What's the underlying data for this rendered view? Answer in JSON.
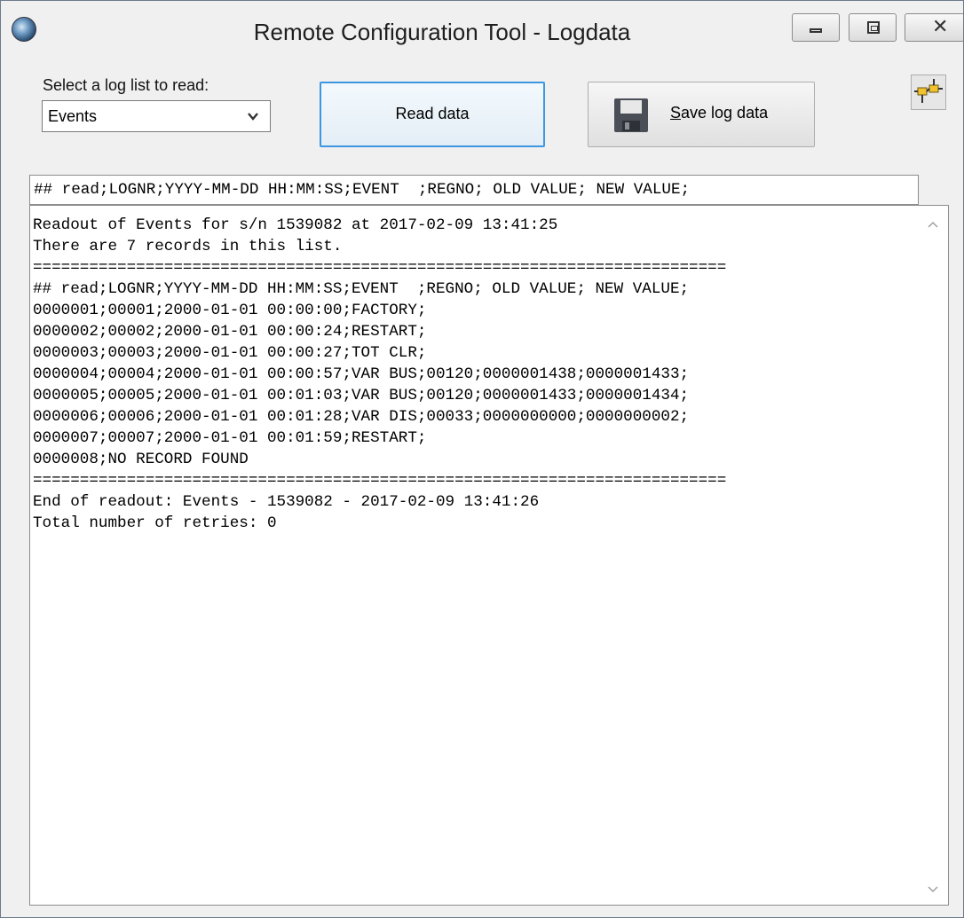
{
  "window": {
    "title": "Remote Configuration Tool - Logdata",
    "close_glyph": "✕"
  },
  "controls": {
    "select_label": "Select a log list to read:",
    "selected_list": "Events",
    "read_button": "Read data",
    "save_button_mnemonic": "S",
    "save_button_rest": "ave log data"
  },
  "header_line": "## read;LOGNR;YYYY-MM-DD HH:MM:SS;EVENT  ;REGNO; OLD VALUE; NEW VALUE;",
  "log": {
    "lines": [
      "Readout of Events for s/n 1539082 at 2017-02-09 13:41:25",
      "There are 7 records in this list.",
      "==========================================================================",
      "## read;LOGNR;YYYY-MM-DD HH:MM:SS;EVENT  ;REGNO; OLD VALUE; NEW VALUE;",
      "0000001;00001;2000-01-01 00:00:00;FACTORY;",
      "0000002;00002;2000-01-01 00:00:24;RESTART;",
      "0000003;00003;2000-01-01 00:00:27;TOT CLR;",
      "0000004;00004;2000-01-01 00:00:57;VAR BUS;00120;0000001438;0000001433;",
      "0000005;00005;2000-01-01 00:01:03;VAR BUS;00120;0000001433;0000001434;",
      "0000006;00006;2000-01-01 00:01:28;VAR DIS;00033;0000000000;0000000002;",
      "0000007;00007;2000-01-01 00:01:59;RESTART;",
      "0000008;NO RECORD FOUND",
      "==========================================================================",
      "End of readout: Events - 1539082 - 2017-02-09 13:41:26",
      "Total number of retries: 0"
    ]
  },
  "icons": {
    "app": "globe-icon",
    "select_arrow": "chevron-down-icon",
    "save": "floppy-disk-icon",
    "connect": "plug-connector-icon",
    "scroll_up": "chevron-up-icon",
    "scroll_down": "chevron-down-icon"
  },
  "colors": {
    "read_button_border": "#3c97e0",
    "window_bg": "#f0f0f0"
  }
}
